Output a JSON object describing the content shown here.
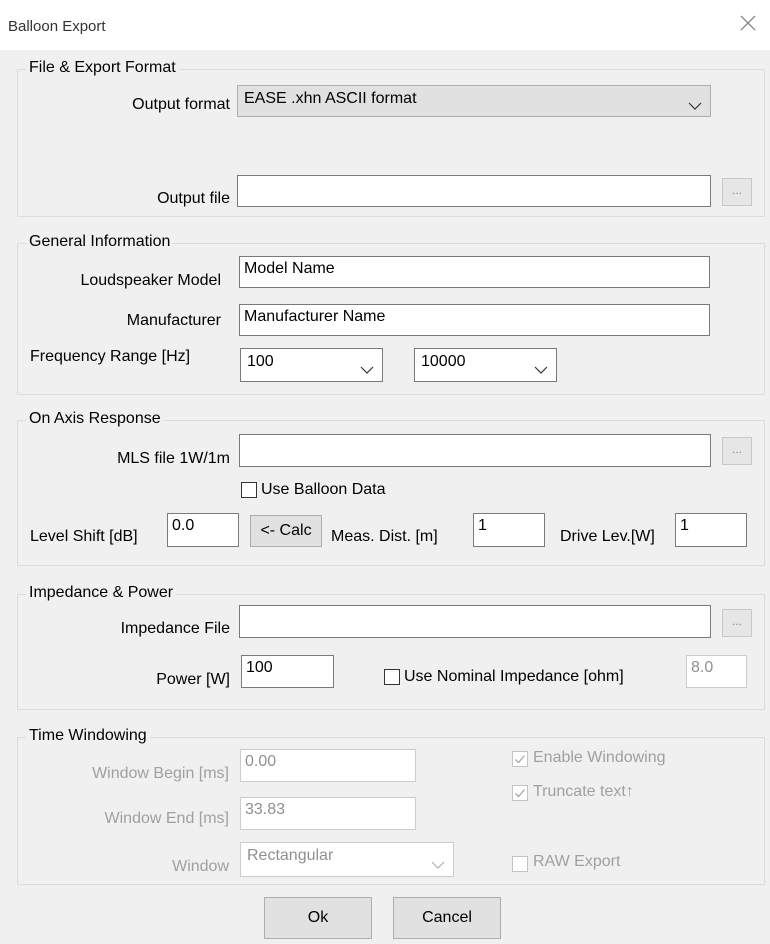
{
  "window": {
    "title": "Balloon Export"
  },
  "icons": {
    "close": "close-icon",
    "dropdown": "chevron-down-icon",
    "browse": "ellipsis-icon",
    "check": "checkmark-icon"
  },
  "file_export": {
    "legend": "File & Export Format",
    "output_format_label": "Output format",
    "output_format_value": "EASE .xhn ASCII format",
    "output_file_label": "Output file",
    "output_file_value": "",
    "browse_label": "..."
  },
  "general": {
    "legend": "General Information",
    "model_label": "Loudspeaker Model",
    "model_value": "Model Name",
    "manufacturer_label": "Manufacturer",
    "manufacturer_value": "Manufacturer Name",
    "freq_label": "Frequency Range [Hz]",
    "freq_min": "100",
    "freq_max": "10000"
  },
  "on_axis": {
    "legend": "On Axis Response",
    "mls_label": "MLS file 1W/1m",
    "mls_value": "",
    "browse_label": "...",
    "use_balloon_label": "Use Balloon Data",
    "use_balloon_checked": false,
    "level_shift_label": "Level Shift [dB]",
    "level_shift_value": "0.0",
    "calc_label": "<- Calc",
    "meas_dist_label": "Meas. Dist. [m]",
    "meas_dist_value": "1",
    "drive_level_label": "Drive Lev.[W]",
    "drive_level_value": "1"
  },
  "impedance": {
    "legend": "Impedance & Power",
    "file_label": "Impedance File",
    "file_value": "",
    "browse_label": "...",
    "power_label": "Power [W]",
    "power_value": "100",
    "nominal_label": "Use Nominal Impedance [ohm]",
    "nominal_checked": false,
    "nominal_value": "8.0"
  },
  "time_windowing": {
    "legend": "Time Windowing",
    "begin_label": "Window Begin [ms]",
    "begin_value": "0.00",
    "end_label": "Window End [ms]",
    "end_value": "33.83",
    "window_label": "Window",
    "window_value": "Rectangular",
    "enable_label": "Enable Windowing",
    "enable_checked": true,
    "truncate_label": "Truncate text↑",
    "truncate_checked": true,
    "raw_label": "RAW Export",
    "raw_checked": false
  },
  "buttons": {
    "ok": "Ok",
    "cancel": "Cancel"
  }
}
